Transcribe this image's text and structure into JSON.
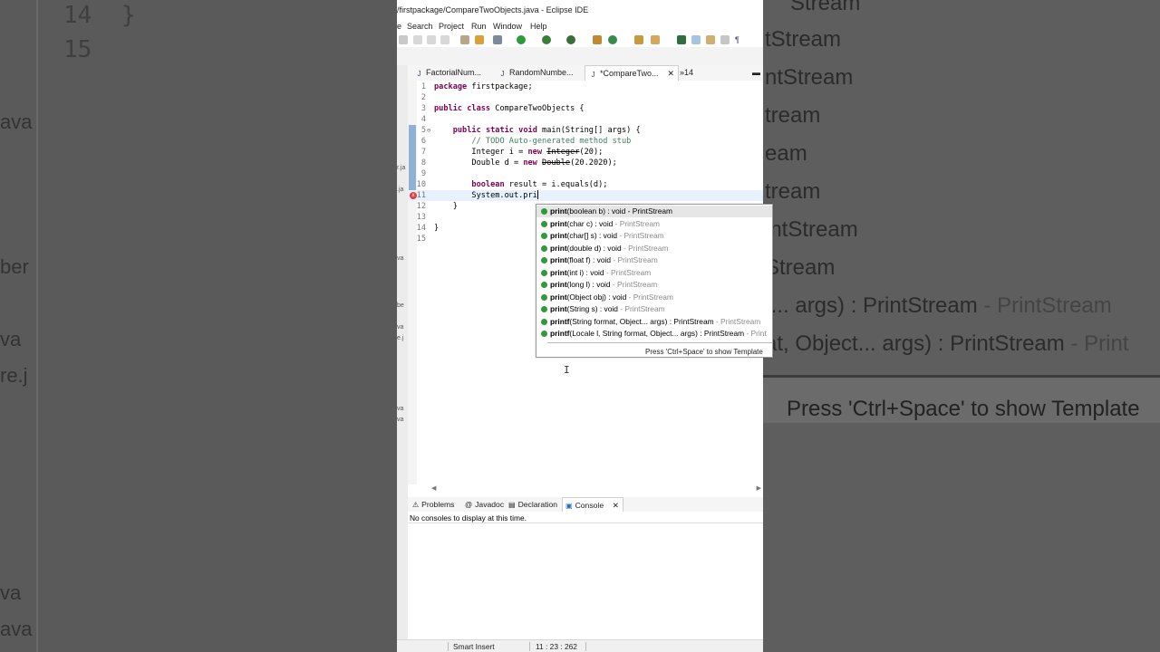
{
  "window": {
    "title": "/firstpackage/CompareTwoObjects.java - Eclipse IDE"
  },
  "menu": [
    "e",
    "Search",
    "Project",
    "Run",
    "Window",
    "Help"
  ],
  "editor_tabs": [
    {
      "label": "FactorialNum...",
      "active": false
    },
    {
      "label": "RandomNumbe...",
      "active": false
    },
    {
      "label": "*CompareTwo...",
      "active": true
    }
  ],
  "overflow_tabs": {
    "label": "»14"
  },
  "code": {
    "lines": [
      {
        "n": "1",
        "text": "package firstpackage;"
      },
      {
        "n": "2",
        "text": ""
      },
      {
        "n": "3",
        "text": "public class CompareTwoObjects {"
      },
      {
        "n": "4",
        "text": ""
      },
      {
        "n": "5",
        "text": "    public static void main(String[] args) {"
      },
      {
        "n": "6",
        "text": "        // TODO Auto-generated method stub"
      },
      {
        "n": "7",
        "text": "        Integer i = new Integer(20);"
      },
      {
        "n": "8",
        "text": "        Double d = new Double(20.2020);"
      },
      {
        "n": "9",
        "text": ""
      },
      {
        "n": "10",
        "text": "        boolean result = i.equals(d);"
      },
      {
        "n": "11",
        "text": "        System.out.pri"
      },
      {
        "n": "12",
        "text": "    }"
      },
      {
        "n": "13",
        "text": ""
      },
      {
        "n": "14",
        "text": "}"
      },
      {
        "n": "15",
        "text": ""
      }
    ]
  },
  "completion": {
    "items": [
      {
        "name": "print",
        "sig": "(boolean b) : void - PrintStream",
        "type": ""
      },
      {
        "name": "print",
        "sig": "(char c) : void",
        "type": " - PrintStream"
      },
      {
        "name": "print",
        "sig": "(char[] s) : void",
        "type": " - PrintStream"
      },
      {
        "name": "print",
        "sig": "(double d) : void",
        "type": " - PrintStream"
      },
      {
        "name": "print",
        "sig": "(float f) : void",
        "type": " - PrintStream"
      },
      {
        "name": "print",
        "sig": "(int i) : void",
        "type": " - PrintStream"
      },
      {
        "name": "print",
        "sig": "(long l) : void",
        "type": " - PrintStream"
      },
      {
        "name": "print",
        "sig": "(Object obj) : void",
        "type": " - PrintStream"
      },
      {
        "name": "print",
        "sig": "(String s) : void",
        "type": " - PrintStream"
      },
      {
        "name": "printf",
        "sig": "(String format, Object... args) : PrintStream",
        "type": " - PrintStream"
      },
      {
        "name": "printf",
        "sig": "(Locale l, String format, Object... args) : PrintStream",
        "type": " - Print"
      }
    ],
    "hint": "Press 'Ctrl+Space' to show Template"
  },
  "bottom_tabs": [
    {
      "label": "Problems",
      "icon": "problems-icon"
    },
    {
      "label": "Javadoc",
      "icon": "javadoc-icon"
    },
    {
      "label": "Declaration",
      "icon": "declaration-icon"
    },
    {
      "label": "Console",
      "icon": "console-icon",
      "active": true
    }
  ],
  "console": {
    "message": "No consoles to display at this time."
  },
  "status": {
    "mode": "Smart Insert",
    "position": "11 : 23 : 262"
  },
  "background": {
    "left_numbers": [
      "14",
      "15"
    ],
    "left_brace": "}",
    "left_fragments": [
      "ava",
      "ber",
      "va",
      "re.j",
      "va",
      "ava"
    ],
    "right_lines": [
      "Stream",
      "tStream",
      "ntStream",
      "tream",
      "eam",
      "tream",
      "intStream",
      "Stream"
    ],
    "right_big": [
      {
        "main": "t... args) : PrintStream",
        "muted": " - PrintStream"
      },
      {
        "main": "at, Object... args) : PrintStream",
        "muted": " - Print"
      }
    ],
    "right_hint": "Press 'Ctrl+Space' to show Template"
  },
  "colors": {
    "keyword": "#7f0055",
    "comment": "#3f7f5f",
    "error": "#e04040",
    "method-dot": "#2f9a3a",
    "current-line": "#e8f2fe"
  }
}
